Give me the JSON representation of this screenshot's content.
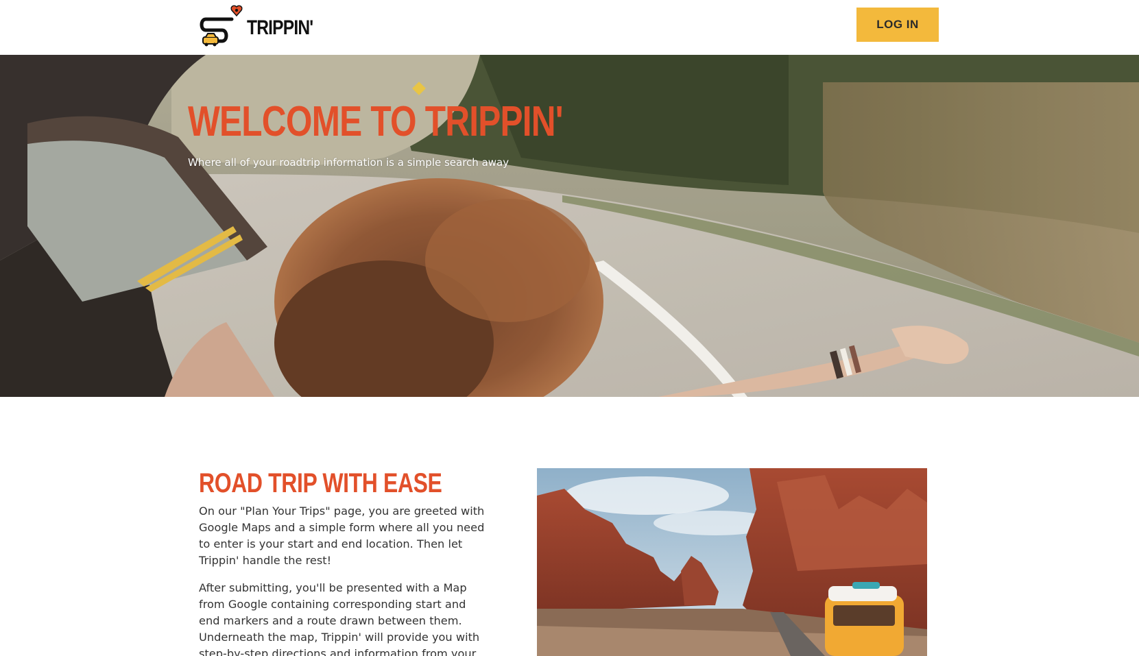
{
  "header": {
    "brand": "TRIPPIN'",
    "login_label": "LOG IN"
  },
  "hero": {
    "title": "WELCOME TO TRIPPIN'",
    "subtitle": "Where all of your roadtrip information is a simple search away"
  },
  "feature": {
    "title": "ROAD TRIP WITH EASE",
    "paragraphs": [
      "On our \"Plan Your Trips\" page, you are greeted with Google Maps and a simple form where all you need to enter is your start and end location. Then let Trippin' handle the rest!",
      "After submitting, you'll be presented with a Map from Google containing corresponding start and end markers and a route drawn between them. Underneath the map, Trippin' will provide you with step-by-step directions and information from your"
    ]
  },
  "colors": {
    "accent_orange": "#e2502a",
    "button_yellow": "#f3b93c",
    "text_dark": "#333333"
  },
  "icons": {
    "logo": "car-road-heart-logo-icon"
  }
}
